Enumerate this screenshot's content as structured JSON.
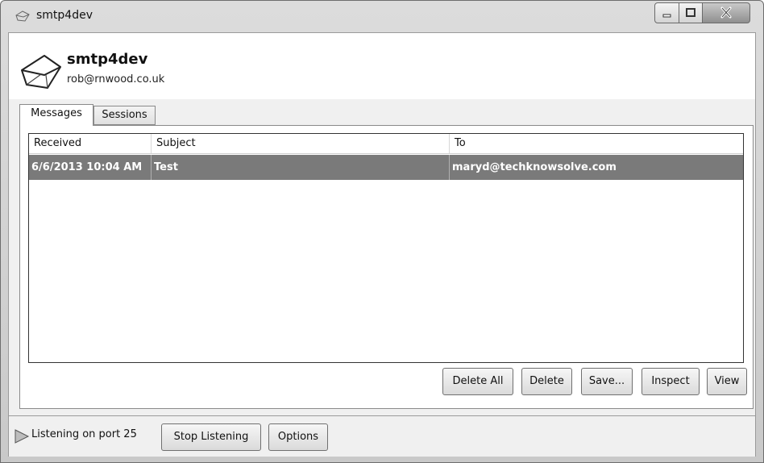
{
  "window": {
    "title": "smtp4dev"
  },
  "header": {
    "app_name": "smtp4dev",
    "email": "rob@rnwood.co.uk"
  },
  "tabs": [
    {
      "label": "Messages",
      "active": true
    },
    {
      "label": "Sessions",
      "active": false
    }
  ],
  "messages": {
    "columns": [
      "Received",
      "Subject",
      "To"
    ],
    "rows": [
      {
        "received": "6/6/2013 10:04 AM",
        "subject": "Test",
        "to": "maryd@techknowsolve.com",
        "selected": true
      }
    ]
  },
  "actions": {
    "delete_all": "Delete All",
    "delete": "Delete",
    "save": "Save...",
    "inspect": "Inspect",
    "view": "View"
  },
  "status": {
    "text": "Listening on port 25",
    "stop_listening": "Stop Listening",
    "options": "Options"
  },
  "icons": {
    "window": "envelope-outline-icon",
    "header": "envelope-icon",
    "status": "play-icon"
  }
}
